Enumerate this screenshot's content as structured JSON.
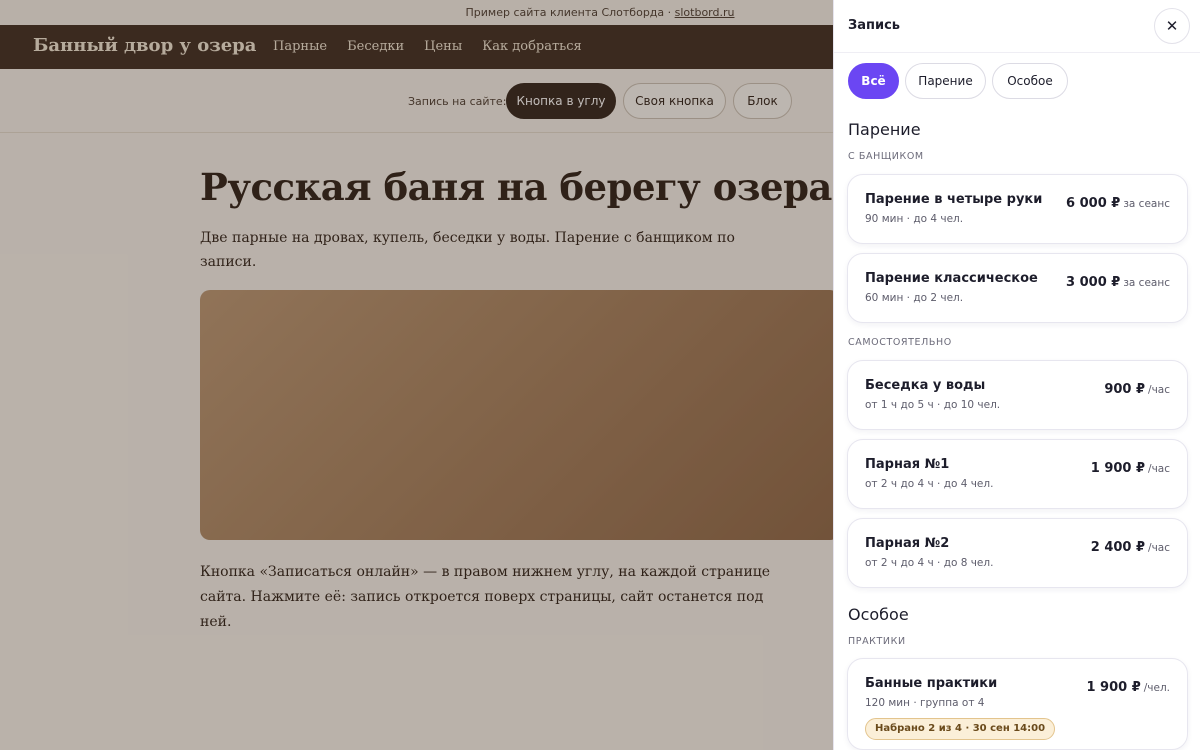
{
  "site": {
    "topnote_text": "Пример сайта клиента Слотборда · ",
    "topnote_link": "slotbord.ru",
    "brand": "Банный двор у озера",
    "nav": [
      "Парные",
      "Беседки",
      "Цены",
      "Как добраться"
    ],
    "booking_label": "Запись на сайте:",
    "booking_options": [
      "Кнопка в углу",
      "Своя кнопка",
      "Блок"
    ],
    "booking_selected": "Кнопка в углу",
    "hero_title": "Русская баня на берегу озера",
    "hero_lead": "Две парные на дровах, купель, беседки у воды. Парение с банщиком по записи.",
    "hero_text": "Кнопка «Записаться онлайн» — в правом нижнем углу, на каждой странице сайта. Нажмите её: запись откроется поверх страницы, сайт останется под ней."
  },
  "drawer": {
    "title": "Запись",
    "close_icon": "close-icon",
    "filters": [
      "Всё",
      "Парение",
      "Особое"
    ],
    "active_filter": "Всё",
    "sections": [
      {
        "title": "Парение",
        "groups": [
          {
            "subtitle": "С БАНЩИКОМ",
            "cards": [
              {
                "name": "Парение в четыре руки",
                "meta": "90 мин · до 4 чел.",
                "price": "6 000 ₽",
                "unit": "за сеанс"
              },
              {
                "name": "Парение классическое",
                "meta": "60 мин · до 2 чел.",
                "price": "3 000 ₽",
                "unit": "за сеанс"
              }
            ]
          },
          {
            "subtitle": "САМОСТОЯТЕЛЬНО",
            "cards": [
              {
                "name": "Беседка у воды",
                "meta": "от 1 ч до 5 ч · до 10 чел.",
                "price": "900 ₽",
                "unit": "/час"
              },
              {
                "name": "Парная №1",
                "meta": "от 2 ч до 4 ч · до 4 чел.",
                "price": "1 900 ₽",
                "unit": "/час"
              },
              {
                "name": "Парная №2",
                "meta": "от 2 ч до 4 ч · до 8 чел.",
                "price": "2 400 ₽",
                "unit": "/час"
              }
            ]
          }
        ]
      },
      {
        "title": "Особое",
        "groups": [
          {
            "subtitle": "ПРАКТИКИ",
            "cards": [
              {
                "name": "Банные практики",
                "meta": "120 мин · группа от 4",
                "price": "1 900 ₽",
                "unit": "/чел.",
                "badge": "Набрано 2 из 4 · 30 сен 14:00"
              }
            ]
          }
        ]
      }
    ]
  }
}
